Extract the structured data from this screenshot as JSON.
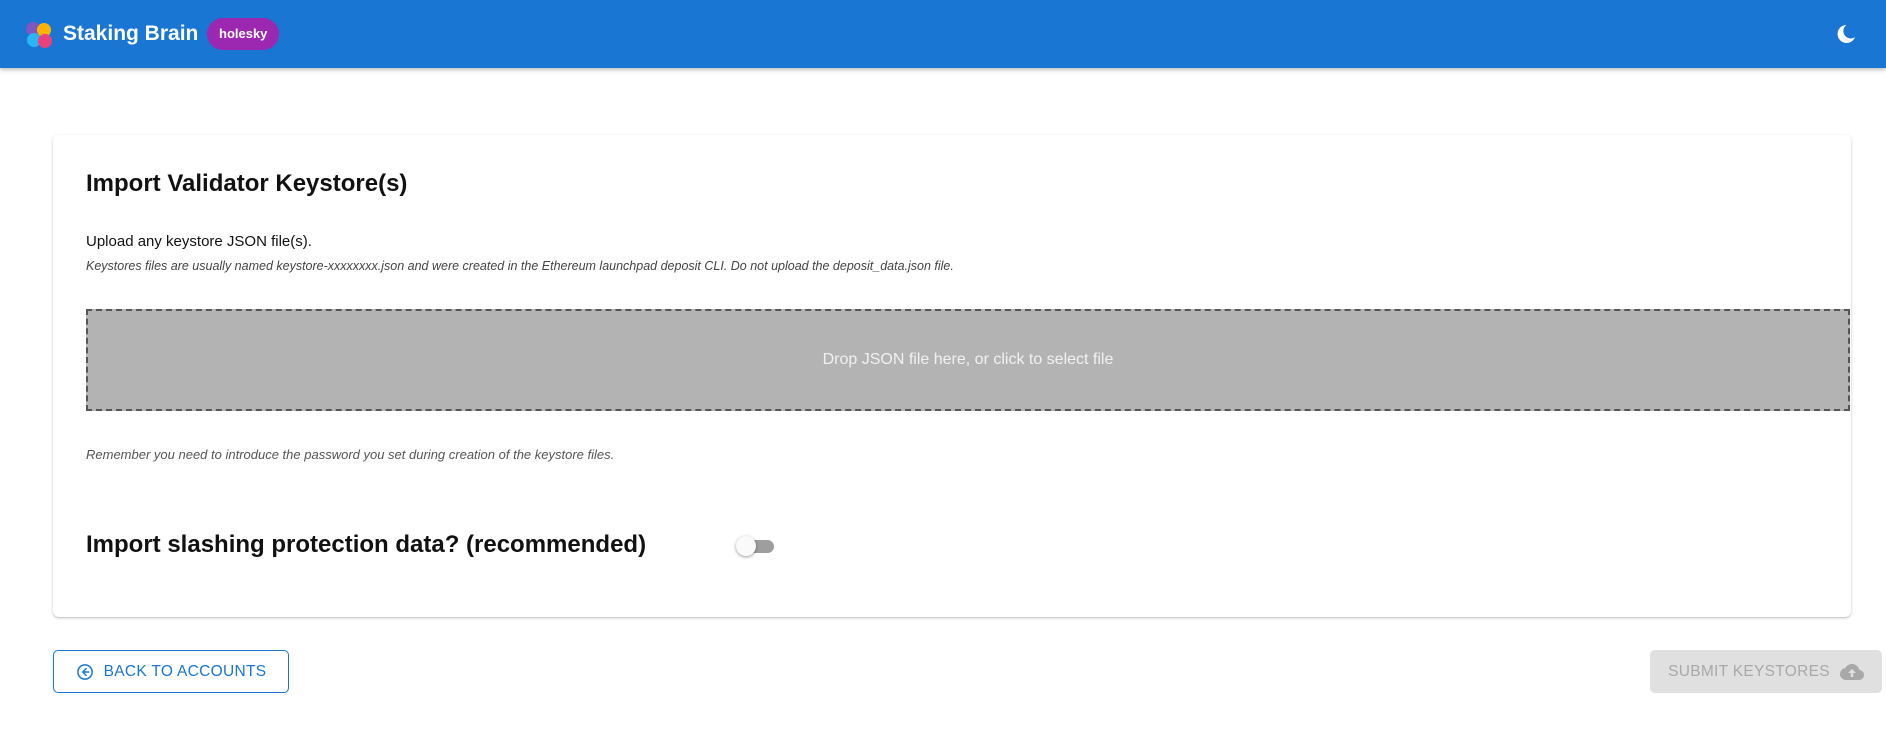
{
  "header": {
    "app_name": "Staking Brain",
    "network": "holesky",
    "logo_icon": "staking-brain-logo",
    "theme_icon": "moon-icon"
  },
  "card": {
    "title": "Import Validator Keystore(s)",
    "upload_text": "Upload any keystore JSON file(s).",
    "upload_hint": "Keystores files are usually named keystore-xxxxxxxx.json and were created in the Ethereum launchpad deposit CLI. Do not upload the deposit_data.json file.",
    "dropzone_text": "Drop JSON file here, or click to select file",
    "password_note": "Remember you need to introduce the password you set during creation of the keystore files.",
    "slashing_title": "Import slashing protection data? (recommended)",
    "slashing_enabled": false
  },
  "footer": {
    "back_label": "BACK TO ACCOUNTS",
    "back_icon": "arrow-circle-left-icon",
    "submit_label": "SUBMIT KEYSTORES",
    "submit_icon": "cloud-upload-icon",
    "submit_disabled": true
  },
  "colors": {
    "primary": "#1976d2",
    "badge": "#9c27b0",
    "dropzone": "#b3b3b3",
    "disabled": "#e0e0e0"
  }
}
